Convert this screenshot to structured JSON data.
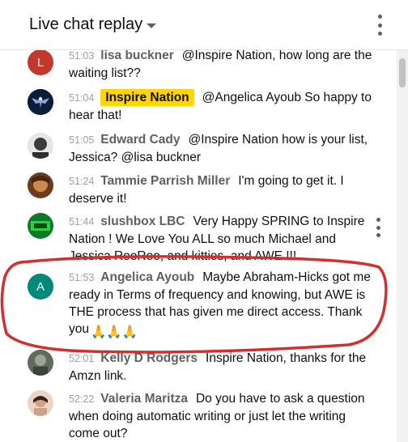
{
  "header": {
    "title": "Live chat replay",
    "caret_icon": "caret-down-icon",
    "menu_icon": "more-vert-icon"
  },
  "colors": {
    "owner_badge": "#ffd600",
    "author_text": "#606060",
    "timestamp_text": "#9aa0a6",
    "annotation_ring": "#d32f2f",
    "letter_avatar_l": "#c0392b",
    "letter_avatar_a": "#00897b"
  },
  "messages": [
    {
      "time": "51:03",
      "author": "lisa buckner",
      "text": "@Inspire Nation, how long are the waiting list??",
      "avatar": "L",
      "owner": false
    },
    {
      "time": "51:04",
      "author": "Inspire Nation",
      "text": "@Angelica Ayoub So happy to hear that!",
      "avatar": "eagle-logo",
      "owner": true
    },
    {
      "time": "51:05",
      "author": "Edward Cady",
      "text": "@Inspire Nation how is your list, Jessica? @lisa buckner",
      "avatar": "photo",
      "owner": false
    },
    {
      "time": "51:24",
      "author": "Tammie Parrish Miller",
      "text": "I'm going to get it. I deserve it!",
      "avatar": "photo",
      "owner": false
    },
    {
      "time": "51:44",
      "author": "slushbox LBC",
      "text": "Very Happy SPRING to Inspire Nation ! We Love You ALL so much Michael and Jessica RooRoo, and kitties, and AWE !!!",
      "avatar": "photo",
      "owner": false
    },
    {
      "time": "51:53",
      "author": "Angelica Ayoub",
      "text": "Maybe Abraham-Hicks got me ready in Terms of frequency and knowing, but AWE is THE process that has given me direct access. Thank you",
      "emoji": "🙏🙏🙏",
      "avatar": "A",
      "owner": false
    },
    {
      "time": "52:01",
      "author": "Kelly D Rodgers",
      "text": "Inspire Nation, thanks for the Amzn link.",
      "avatar": "photo",
      "owner": false
    },
    {
      "time": "52:22",
      "author": "Valeria Maritza",
      "text": "Do you have to ask a question when doing automatic writing or just let the writing come out?",
      "avatar": "photo",
      "owner": false
    }
  ]
}
